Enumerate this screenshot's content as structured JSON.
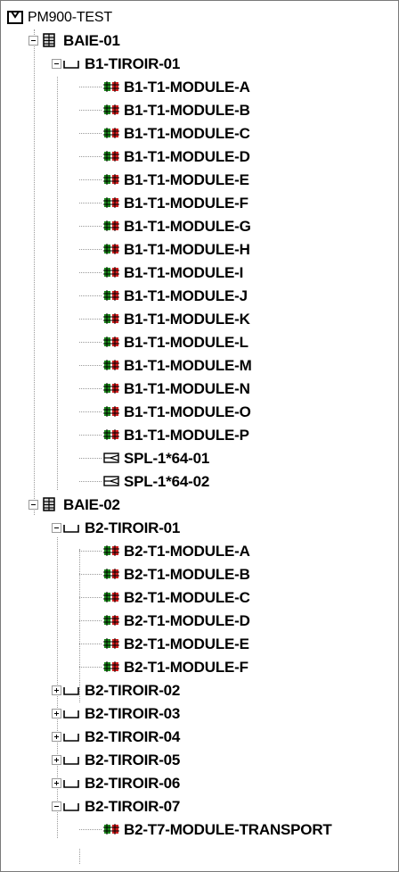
{
  "tree": {
    "root": "PM900-TEST",
    "baie1": "BAIE-01",
    "b1_tiroir": "B1-TIROIR-01",
    "b1_modules": [
      "B1-T1-MODULE-A",
      "B1-T1-MODULE-B",
      "B1-T1-MODULE-C",
      "B1-T1-MODULE-D",
      "B1-T1-MODULE-E",
      "B1-T1-MODULE-F",
      "B1-T1-MODULE-G",
      "B1-T1-MODULE-H",
      "B1-T1-MODULE-I",
      "B1-T1-MODULE-J",
      "B1-T1-MODULE-K",
      "B1-T1-MODULE-L",
      "B1-T1-MODULE-M",
      "B1-T1-MODULE-N",
      "B1-T1-MODULE-O",
      "B1-T1-MODULE-P"
    ],
    "splitters": [
      "SPL-1*64-01",
      "SPL-1*64-02"
    ],
    "baie2": "BAIE-02",
    "b2_tiroir1": "B2-TIROIR-01",
    "b2_modules": [
      "B2-T1-MODULE-A",
      "B2-T1-MODULE-B",
      "B2-T1-MODULE-C",
      "B2-T1-MODULE-D",
      "B2-T1-MODULE-E",
      "B2-T1-MODULE-F"
    ],
    "b2_tiroirs_collapsed": [
      "B2-TIROIR-02",
      "B2-TIROIR-03",
      "B2-TIROIR-04",
      "B2-TIROIR-05",
      "B2-TIROIR-06"
    ],
    "b2_tiroir7": "B2-TIROIR-07",
    "b2_t7_module": "B2-T7-MODULE-TRANSPORT"
  },
  "icons": {
    "root": "network-root-icon",
    "baie": "rack-icon",
    "tiroir": "drawer-icon",
    "module": "module-icon",
    "splitter": "splitter-icon"
  },
  "colors": {
    "module_green": "#1e8a1e",
    "module_red": "#d02020",
    "line_gray": "#9a9a9a"
  }
}
